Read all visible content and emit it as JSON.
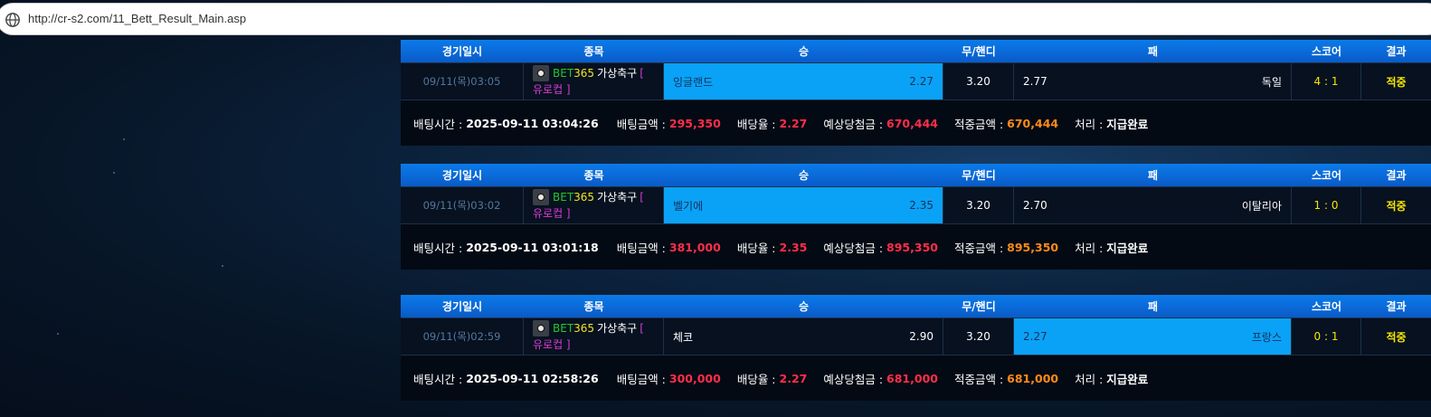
{
  "browser": {
    "url": "http://cr-s2.com/11_Bett_Result_Main.asp"
  },
  "headers": {
    "date": "경기일시",
    "event": "종목",
    "win": "승",
    "draw": "무/핸디",
    "lose": "패",
    "score": "스코어",
    "result": "결과"
  },
  "info_labels": {
    "bet_time": "배팅시간 :",
    "bet_amount": "배팅금액 :",
    "odds": "배당율 :",
    "expected": "예상당첨금 :",
    "hit_amount": "적중금액 :",
    "process": "처리 :"
  },
  "bets": [
    {
      "date": "09/11(목)03:05",
      "event_bet": "BET",
      "event_365": "365",
      "event_name": "가상축구",
      "event_bracket": "[",
      "event_league": "유로컵 ]",
      "home_team": "잉글랜드",
      "home_odds": "2.27",
      "draw_odds": "3.20",
      "away_odds": "2.77",
      "away_team": "독일",
      "score": "4 : 1",
      "result": "적중",
      "selected": "home",
      "bet_time": "2025-09-11 03:04:26",
      "bet_amount": "295,350",
      "odds": "2.27",
      "expected": "670,444",
      "hit_amount": "670,444",
      "process": "지급완료"
    },
    {
      "date": "09/11(목)03:02",
      "event_bet": "BET",
      "event_365": "365",
      "event_name": "가상축구",
      "event_bracket": "[",
      "event_league": "유로컵 ]",
      "home_team": "벨기에",
      "home_odds": "2.35",
      "draw_odds": "3.20",
      "away_odds": "2.70",
      "away_team": "이탈리아",
      "score": "1 : 0",
      "result": "적중",
      "selected": "home",
      "bet_time": "2025-09-11 03:01:18",
      "bet_amount": "381,000",
      "odds": "2.35",
      "expected": "895,350",
      "hit_amount": "895,350",
      "process": "지급완료"
    },
    {
      "date": "09/11(목)02:59",
      "event_bet": "BET",
      "event_365": "365",
      "event_name": "가상축구",
      "event_bracket": "[",
      "event_league": "유로컵 ]",
      "home_team": "체코",
      "home_odds": "2.90",
      "draw_odds": "3.20",
      "away_odds": "2.27",
      "away_team": "프랑스",
      "score": "0 : 1",
      "result": "적중",
      "selected": "away",
      "bet_time": "2025-09-11 02:58:26",
      "bet_amount": "300,000",
      "odds": "2.27",
      "expected": "681,000",
      "hit_amount": "681,000",
      "process": "지급완료"
    }
  ]
}
